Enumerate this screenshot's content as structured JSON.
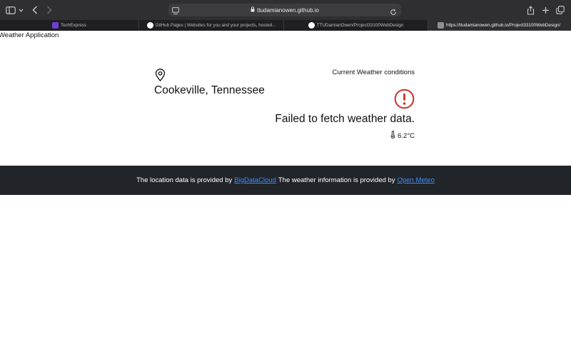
{
  "browser": {
    "url": "ttudamianowen.github.io",
    "tabs": [
      {
        "label": "TechExpress",
        "active": false,
        "favicon_color": "#6b3fd6"
      },
      {
        "label": "GitHub Pages | Websites for you and your projects, hosted...",
        "active": false,
        "favicon_color": "#ffffff"
      },
      {
        "label": "TTUDamianOwen/Project33100WebDesign",
        "active": false,
        "favicon_color": "#ffffff"
      },
      {
        "label": "https://ttudamianowen.github.io/Project33100WebDesign/",
        "active": true,
        "favicon_color": "#8e8e93"
      }
    ]
  },
  "page": {
    "title": "Weather Application",
    "location": "Cookeville, Tennessee",
    "current_label": "Current Weather conditions",
    "error_message": "Failed to fetch weather data.",
    "temperature": "6.2°C"
  },
  "footer": {
    "text_1": "The location data is provided by",
    "link_1": "BigDataCloud",
    "text_2": "The weather information is provided by",
    "link_2": "Open Meteo"
  },
  "colors": {
    "alert": "#c9302c",
    "link": "#3d8bfd",
    "footer_bg": "#212529"
  }
}
